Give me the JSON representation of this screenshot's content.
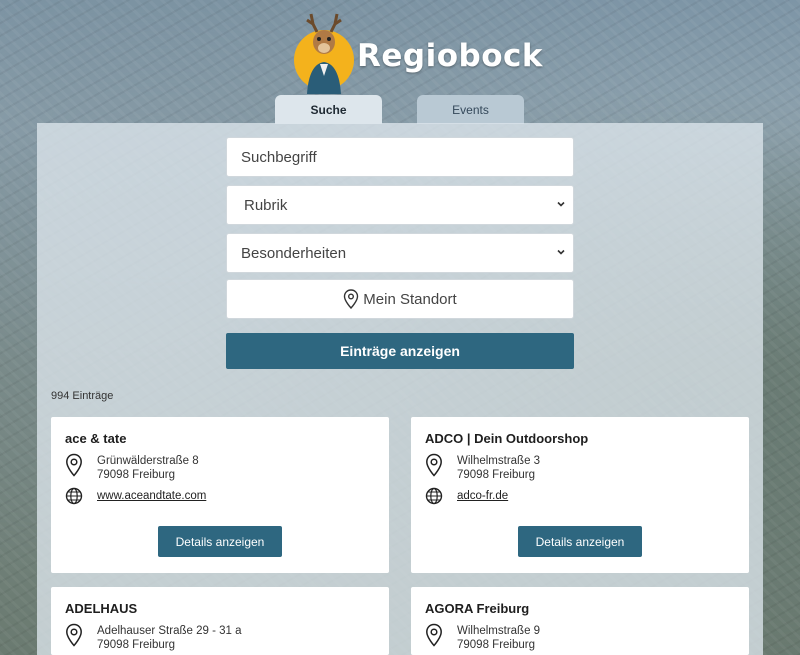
{
  "brand": {
    "name": "Regiobock"
  },
  "tabs": [
    {
      "label": "Suche",
      "active": true
    },
    {
      "label": "Events",
      "active": false
    }
  ],
  "search": {
    "keyword_placeholder": "Suchbegriff",
    "category_value": "Rubrik",
    "features_value": "Besonderheiten",
    "location_label": "Mein Standort",
    "submit_label": "Einträge anzeigen"
  },
  "results": {
    "count_label": "994 Einträge",
    "details_label": "Details anzeigen",
    "items": [
      {
        "name": "ace & tate",
        "street": "Grünwälderstraße 8",
        "city": "79098 Freiburg",
        "web": "www.aceandtate.com"
      },
      {
        "name": "ADCO | Dein Outdoorshop",
        "street": "Wilhelmstraße 3",
        "city": "79098 Freiburg",
        "web": "adco-fr.de"
      },
      {
        "name": "ADELHAUS",
        "street": "Adelhauser Straße 29 - 31 a",
        "city": "79098 Freiburg",
        "web": ""
      },
      {
        "name": "AGORA Freiburg",
        "street": "Wilhelmstraße 9",
        "city": "79098 Freiburg",
        "web": ""
      }
    ]
  },
  "colors": {
    "primary": "#2e6780",
    "tab_active": "#dde6ec",
    "tab_inactive": "#b9c9d4"
  }
}
